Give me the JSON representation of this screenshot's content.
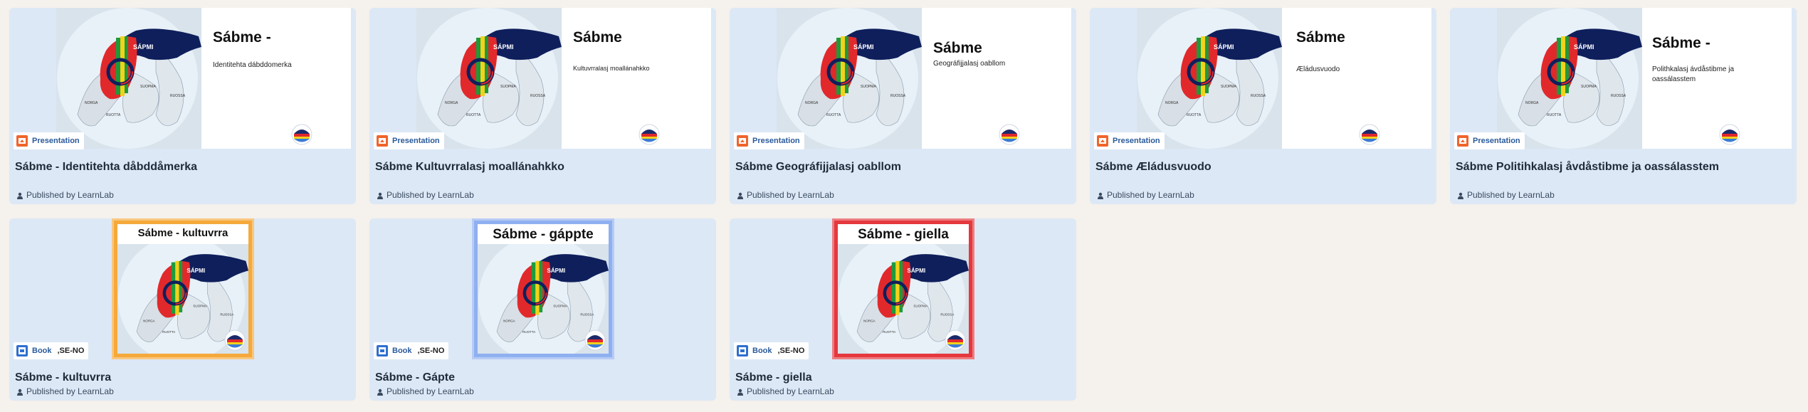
{
  "presentations": [
    {
      "slide_title": "Sábme -",
      "slide_subtitle": "Identitehta dábddomerka",
      "type_label": "Presentation",
      "title": "Sábme - Identitehta dåbddåmerka",
      "published": "Published by LearnLab"
    },
    {
      "slide_title": "Sábme",
      "slide_subtitle": "Kultuvrralasj moallánahkko",
      "type_label": "Presentation",
      "title": "Sábme Kultuvrralasj moallánahkko",
      "published": "Published by LearnLab"
    },
    {
      "slide_title": "Sábme",
      "slide_subtitle": "Geográfijjalasj oabllom",
      "type_label": "Presentation",
      "title": "Sábme Geográfijjalasj oabllom",
      "published": "Published by LearnLab"
    },
    {
      "slide_title": "Sábme",
      "slide_subtitle": "Æládusvuodo",
      "type_label": "Presentation",
      "title": "Sábme Æládusvuodo",
      "published": "Published by LearnLab"
    },
    {
      "slide_title": "Sábme -",
      "slide_subtitle": "Polithkalasj ávdåstibme ja oassálasstem",
      "type_label": "Presentation",
      "title": "Sábme Politihkalasj åvdåstibme ja oassálasstem",
      "published": "Published by LearnLab"
    }
  ],
  "books": [
    {
      "cover_title": "Sábme - kultuvrra",
      "frame_color": "#f5a93b",
      "type_label": "Book",
      "lang": ",SE-NO",
      "title": "Sábme - kultuvrra",
      "published": "Published by LearnLab"
    },
    {
      "cover_title": "Sábme - gáppte",
      "frame_color": "#8fb0f0",
      "type_label": "Book",
      "lang": ",SE-NO",
      "title": "Sábme - Gápte",
      "published": "Published by LearnLab"
    },
    {
      "cover_title": "Sábme - giella",
      "frame_color": "#e5383e",
      "type_label": "Book",
      "lang": ",SE-NO",
      "title": "Sábme - giella",
      "published": "Published by LearnLab"
    }
  ],
  "map_labels": {
    "sapmi": "SÁPMI",
    "suopma": "SUOPMA",
    "ruossa": "RUOSSA",
    "norga": "NORGA",
    "ruotta": "RUOTTA"
  },
  "colors": {
    "card_bg": "#dce8f6",
    "page_bg": "#f5f1ec",
    "tag_text": "#2a5a9a",
    "map_red": "#e1292c",
    "map_navy": "#0f1f5c"
  }
}
